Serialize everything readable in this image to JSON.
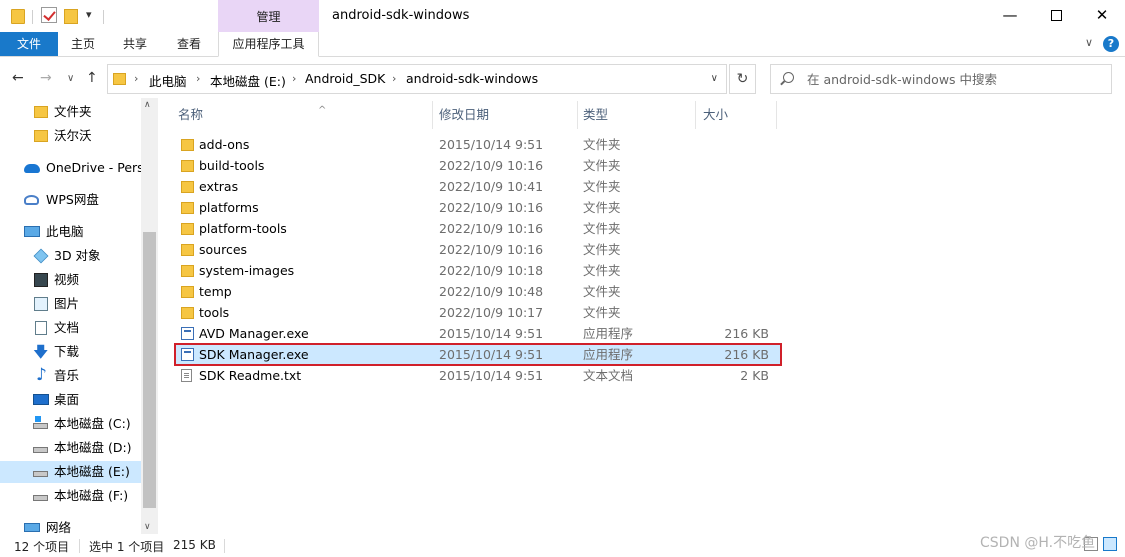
{
  "window": {
    "title": "android-sdk-windows",
    "context_tab_group": "管理"
  },
  "ribbon": {
    "tabs": [
      "文件",
      "主页",
      "共享",
      "查看",
      "应用程序工具"
    ]
  },
  "address": {
    "breadcrumbs": [
      "此电脑",
      "本地磁盘 (E:)",
      "Android_SDK",
      "android-sdk-windows"
    ]
  },
  "search": {
    "placeholder": "在 android-sdk-windows 中搜索"
  },
  "sidebar": {
    "items": [
      {
        "label": "文件夹",
        "icon": "folder-icon"
      },
      {
        "label": "沃尔沃",
        "icon": "folder-icon"
      },
      {
        "label": "OneDrive - Perso",
        "icon": "onedrive-icon"
      },
      {
        "label": "WPS网盘",
        "icon": "wps-cloud-icon"
      },
      {
        "label": "此电脑",
        "icon": "this-pc-icon"
      },
      {
        "label": "3D 对象",
        "icon": "3d-objects-icon"
      },
      {
        "label": "视频",
        "icon": "video-icon"
      },
      {
        "label": "图片",
        "icon": "pictures-icon"
      },
      {
        "label": "文档",
        "icon": "documents-icon"
      },
      {
        "label": "下载",
        "icon": "download-icon"
      },
      {
        "label": "音乐",
        "icon": "music-icon"
      },
      {
        "label": "桌面",
        "icon": "desktop-icon"
      },
      {
        "label": "本地磁盘 (C:)",
        "icon": "drive-icon"
      },
      {
        "label": "本地磁盘 (D:)",
        "icon": "drive-icon"
      },
      {
        "label": "本地磁盘 (E:)",
        "icon": "drive-icon",
        "selected": true
      },
      {
        "label": "本地磁盘 (F:)",
        "icon": "drive-icon"
      },
      {
        "label": "网络",
        "icon": "network-icon"
      }
    ]
  },
  "columns": {
    "name": "名称",
    "date": "修改日期",
    "type": "类型",
    "size": "大小"
  },
  "files": [
    {
      "name": "add-ons",
      "date": "2015/10/14 9:51",
      "type": "文件夹",
      "size": "",
      "kind": "folder"
    },
    {
      "name": "build-tools",
      "date": "2022/10/9 10:16",
      "type": "文件夹",
      "size": "",
      "kind": "folder"
    },
    {
      "name": "extras",
      "date": "2022/10/9 10:41",
      "type": "文件夹",
      "size": "",
      "kind": "folder"
    },
    {
      "name": "platforms",
      "date": "2022/10/9 10:16",
      "type": "文件夹",
      "size": "",
      "kind": "folder"
    },
    {
      "name": "platform-tools",
      "date": "2022/10/9 10:16",
      "type": "文件夹",
      "size": "",
      "kind": "folder"
    },
    {
      "name": "sources",
      "date": "2022/10/9 10:16",
      "type": "文件夹",
      "size": "",
      "kind": "folder"
    },
    {
      "name": "system-images",
      "date": "2022/10/9 10:18",
      "type": "文件夹",
      "size": "",
      "kind": "folder"
    },
    {
      "name": "temp",
      "date": "2022/10/9 10:48",
      "type": "文件夹",
      "size": "",
      "kind": "folder"
    },
    {
      "name": "tools",
      "date": "2022/10/9 10:17",
      "type": "文件夹",
      "size": "",
      "kind": "folder"
    },
    {
      "name": "AVD Manager.exe",
      "date": "2015/10/14 9:51",
      "type": "应用程序",
      "size": "216 KB",
      "kind": "exe"
    },
    {
      "name": "SDK Manager.exe",
      "date": "2015/10/14 9:51",
      "type": "应用程序",
      "size": "216 KB",
      "kind": "exe",
      "selected": true
    },
    {
      "name": "SDK Readme.txt",
      "date": "2015/10/14 9:51",
      "type": "文本文档",
      "size": "2 KB",
      "kind": "txt"
    }
  ],
  "status": {
    "item_count": "12 个项目",
    "selection": "选中 1 个项目",
    "selection_size": "215 KB"
  },
  "watermark": "CSDN @H.不吃鱼",
  "colors": {
    "accent": "#1979ca",
    "selection": "#cce8ff",
    "context_tab": "#e9d6f6",
    "highlight_outline": "#d0202a"
  }
}
